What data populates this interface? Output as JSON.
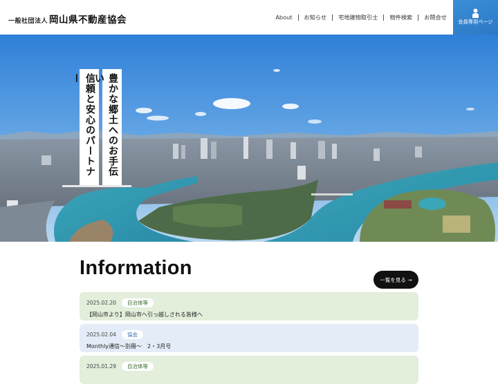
{
  "header": {
    "logo_small": "一般社団法人",
    "logo_big": "岡山県不動産協会",
    "nav": [
      "About",
      "お知らせ",
      "宅地建物取引士",
      "物件検索",
      "お問合せ"
    ],
    "member_label": "会員専用ページ",
    "member_icon": "person-icon"
  },
  "hero": {
    "tagline_1": "信頼と安心のパートナー",
    "tagline_2": "豊かな郷土へのお手伝い"
  },
  "information": {
    "title": "Information",
    "more_label": "一覧を見る →",
    "items": [
      {
        "date": "2025.02.20",
        "category": "自治体等",
        "title": "【岡山市より】岡山市へ引っ越しされる皆様へ"
      },
      {
        "date": "2025.02.04",
        "category": "協会",
        "title": "Monthly通信〜別冊〜　2・3月号"
      },
      {
        "date": "2025.01.29",
        "category": "自治体等",
        "title": ""
      }
    ]
  },
  "colors": {
    "member_button": "#2d78c5",
    "news_green": "#e3eedb",
    "news_blue": "#e3ecf7",
    "button_dark": "#111111"
  }
}
